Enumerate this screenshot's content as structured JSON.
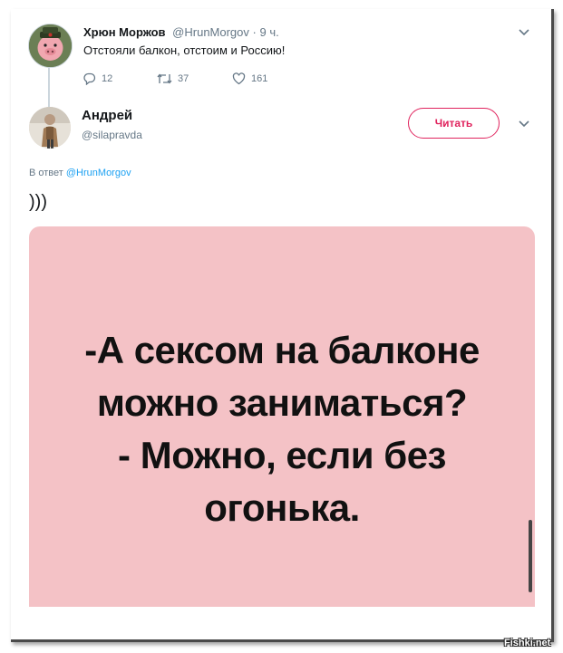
{
  "original_tweet": {
    "name": "Хрюн Моржов",
    "handle": "@HrunMorgov",
    "time": "· 9 ч.",
    "text": "Отстояли балкон, отстоим и Россию!",
    "replies": "12",
    "retweets": "37",
    "likes": "161"
  },
  "reply_tweet": {
    "name": "Андрей",
    "handle": "@silapravda",
    "follow_label": "Читать",
    "reply_to_prefix": "В ответ",
    "reply_to_mention": "@HrunMorgov",
    "text": ")))"
  },
  "image": {
    "lines": [
      "-А сексом  на балконе",
      "можно заниматься?",
      "- Можно, если без",
      "огонька."
    ],
    "background": "#f4c2c6"
  },
  "watermark": "Fishki.net",
  "colors": {
    "accent_pink": "#e0245e",
    "link_blue": "#1da1f2",
    "muted": "#657786"
  }
}
